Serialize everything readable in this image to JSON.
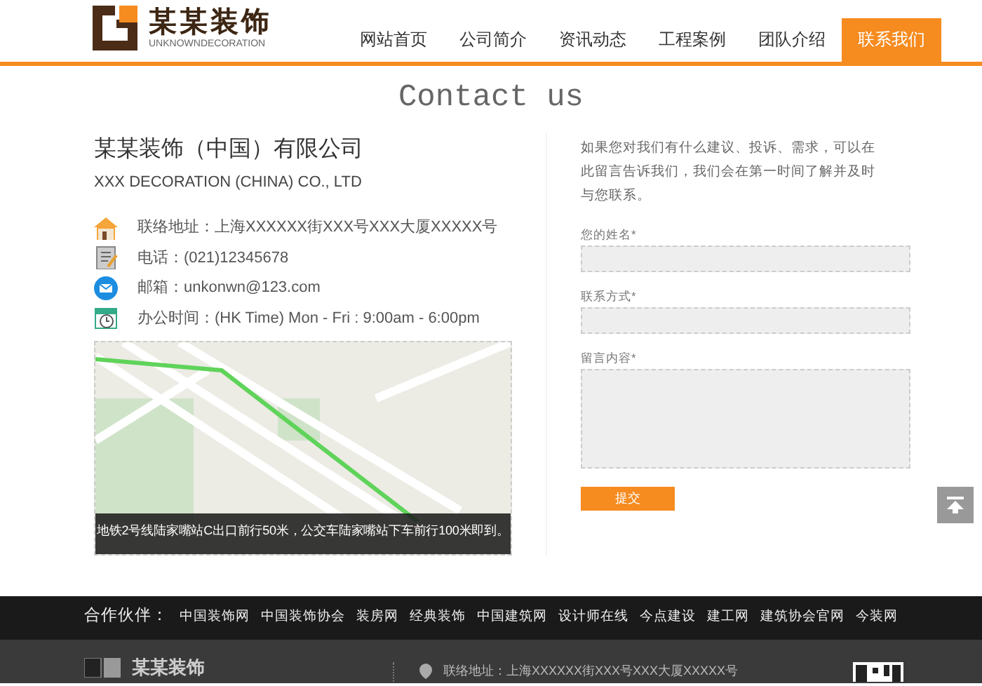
{
  "header": {
    "logo": {
      "name": "某某装饰",
      "tagline": "UNKNOWNDECORATION"
    },
    "nav": [
      {
        "label": "网站首页",
        "selected": false
      },
      {
        "label": "公司简介",
        "selected": false
      },
      {
        "label": "资讯动态",
        "selected": false
      },
      {
        "label": "工程案例",
        "selected": false
      },
      {
        "label": "团队介绍",
        "selected": false
      },
      {
        "label": "联系我们",
        "selected": true
      }
    ]
  },
  "page_title": "Contact us",
  "company": {
    "name": "某某装饰（中国）有限公司",
    "name_en": "XXX DECORATION (CHINA) CO., LTD",
    "contacts": [
      {
        "kind": "address",
        "text": "联络地址：上海XXXXXX街XXX号XXX大厦XXXXX号"
      },
      {
        "kind": "phone",
        "text": "电话：(021)12345678"
      },
      {
        "kind": "email",
        "text": "邮箱：unkonwn@123.com"
      },
      {
        "kind": "hours",
        "text": "办公时间：(HK Time) Mon - Fri : 9:00am - 6:00pm"
      }
    ]
  },
  "map": {
    "caption": "地铁2号线陆家嘴站C出口前行50米，公交车陆家嘴站下车前行100米即到。"
  },
  "form": {
    "intro": "如果您对我们有什么建议、投诉、需求，可以在此留言告诉我们，我们会在第一时间了解并及时与您联系。",
    "fields": [
      {
        "label": "您的姓名*",
        "kind": "text"
      },
      {
        "label": "联系方式*",
        "kind": "text"
      },
      {
        "label": "留言内容*",
        "kind": "textarea"
      }
    ],
    "submit": "提交"
  },
  "footer": {
    "partners_label": "合作伙伴：",
    "partners": [
      "中国装饰网",
      "中国装饰协会",
      "装房网",
      "经典装饰",
      "中国建筑网",
      "设计师在线",
      "今点建设",
      "建工网",
      "建筑协会官网",
      "今装网"
    ],
    "logo_name": "某某装饰",
    "address": "联络地址：上海XXXXXX街XXX号XXX大厦XXXXX号"
  }
}
